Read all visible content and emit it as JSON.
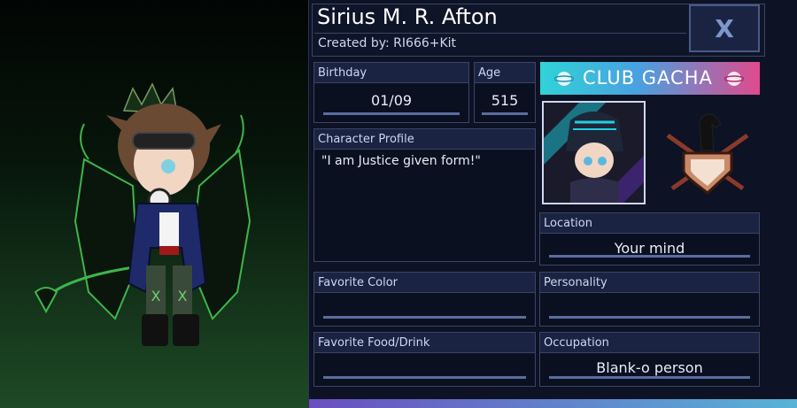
{
  "header": {
    "name": "Sirius M. R. Afton",
    "created_by": "Created by: RI666+Kit",
    "close_label": "X"
  },
  "fields": {
    "birthday": {
      "label": "Birthday",
      "value": "01/09"
    },
    "age": {
      "label": "Age",
      "value": "515"
    },
    "profile": {
      "label": "Character Profile",
      "value": "\"I am Justice given form!\""
    },
    "location": {
      "label": "Location",
      "value": "Your mind"
    },
    "favorite_color": {
      "label": "Favorite Color",
      "value": ""
    },
    "personality": {
      "label": "Personality",
      "value": ""
    },
    "favorite_food": {
      "label": "Favorite Food/Drink",
      "value": ""
    },
    "occupation": {
      "label": "Occupation",
      "value": "Blank-o person"
    }
  },
  "brand": {
    "logo_text": "CLUB GACHA"
  },
  "icons": {
    "close": "close-icon",
    "crest": "knight-shield-crest-icon"
  },
  "colors": {
    "panel_bg": "#0d1224",
    "label_bg": "#1a2342",
    "accent_cyan": "#30d3d8",
    "accent_pink": "#e04a8c"
  }
}
